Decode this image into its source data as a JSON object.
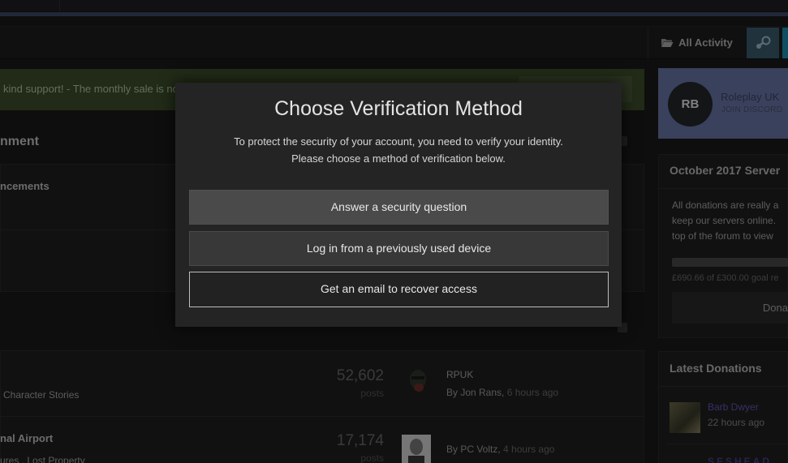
{
  "nav": {
    "all_activity": "All Activity",
    "folder_icon": "folder-open-icon",
    "steam_icon": "steam-icon"
  },
  "notice": {
    "text": "kind support! - The monthly sale is no"
  },
  "forum": {
    "section_title": "nment",
    "category_announcements": "ncements",
    "forums": [
      {
        "subforum": "Character Stories",
        "count": "52,602",
        "count_label": "posts",
        "last_title": "RPUK",
        "last_by": "By Jon Rans,",
        "last_time": "6 hours ago"
      },
      {
        "title": "nal Airport",
        "subforum": "ures , Lost Property",
        "count": "17,174",
        "count_label": "posts",
        "last_by": "By PC Voltz,",
        "last_time": "4 hours ago"
      }
    ]
  },
  "sidebar": {
    "discord": {
      "logo": "RB",
      "name": "Roleplay UK",
      "sub": "JOIN DISCORD"
    },
    "donations": {
      "title": "October 2017 Server",
      "lines": [
        "All donations are really a",
        "keep our servers online.",
        "top of the forum to view"
      ],
      "progress": 1.0,
      "goal": "£690.66 of £300.00 goal re",
      "button": "Dona"
    },
    "latest": {
      "title": "Latest Donations",
      "donors": [
        {
          "name": "Barb Dwyer",
          "time": "22 hours ago"
        }
      ],
      "donor2_partial": "SESHEAD"
    }
  },
  "modal": {
    "title": "Choose Verification Method",
    "desc_line1": "To protect the security of your account, you need to verify your identity.",
    "desc_line2": "Please choose a method of verification below.",
    "options": [
      "Answer a security question",
      "Log in from a previously used device",
      "Get an email to recover access"
    ]
  }
}
